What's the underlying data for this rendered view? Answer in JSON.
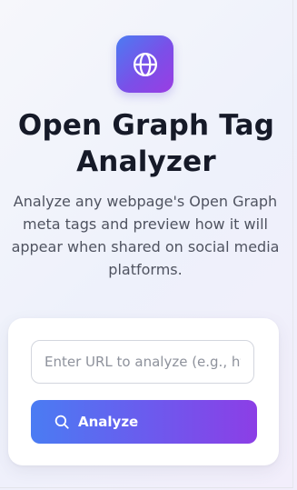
{
  "header": {
    "logo_icon": "globe-icon",
    "title_line1": "Open Graph Tag",
    "title_line2": "Analyzer",
    "description": "Analyze any webpage's Open Graph meta tags and preview how it will appear when shared on social media platforms."
  },
  "form": {
    "url_placeholder": "Enter URL to analyze (e.g., https://example.com)",
    "url_value": "",
    "analyze_label": "Analyze",
    "analyze_icon": "search-icon"
  },
  "colors": {
    "gradient_start": "#4a7cf3",
    "gradient_end": "#8c3ee6",
    "title": "#161a28",
    "text": "#4f5360"
  }
}
